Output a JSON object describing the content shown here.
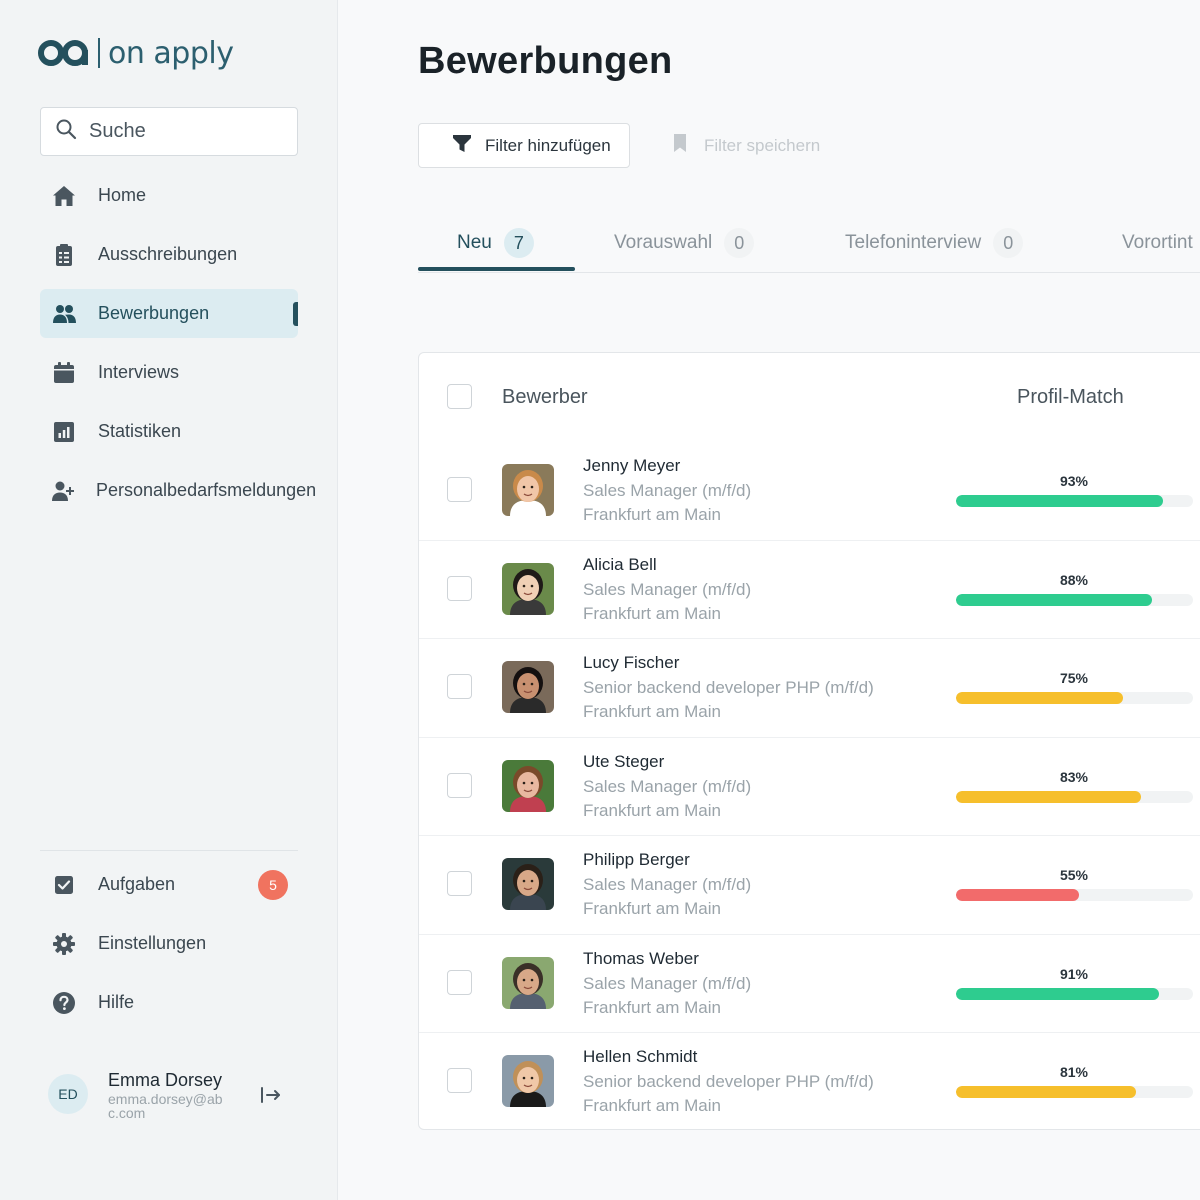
{
  "brand": {
    "name": "on apply",
    "color": "#24505d"
  },
  "search": {
    "placeholder": "Suche"
  },
  "nav": [
    {
      "label": "Home",
      "icon": "home-icon"
    },
    {
      "label": "Ausschreibungen",
      "icon": "clipboard-icon"
    },
    {
      "label": "Bewerbungen",
      "icon": "users-icon",
      "active": true
    },
    {
      "label": "Interviews",
      "icon": "calendar-icon"
    },
    {
      "label": "Statistiken",
      "icon": "chart-icon"
    },
    {
      "label": "Personalbedarfsmeldungen",
      "icon": "user-plus-icon"
    }
  ],
  "bottom_nav": [
    {
      "label": "Aufgaben",
      "icon": "check-square-icon",
      "badge": "5"
    },
    {
      "label": "Einstellungen",
      "icon": "gear-icon"
    },
    {
      "label": "Hilfe",
      "icon": "help-icon"
    }
  ],
  "user": {
    "initials": "ED",
    "name": "Emma Dorsey",
    "email": "emma.dorsey@abc.com"
  },
  "page": {
    "title": "Bewerbungen"
  },
  "toolbar": {
    "filter_label": "Filter hinzufügen",
    "save_label": "Filter speichern"
  },
  "tabs": [
    {
      "label": "Neu",
      "count": "7",
      "active": true
    },
    {
      "label": "Vorauswahl",
      "count": "0"
    },
    {
      "label": "Telefoninterview",
      "count": "0"
    },
    {
      "label": "Vorortint",
      "count": ""
    }
  ],
  "table": {
    "col_applicant": "Bewerber",
    "col_match": "Profil-Match",
    "rows": [
      {
        "name": "Jenny Meyer",
        "job": "Sales Manager (m/f/d)",
        "location": "Frankfurt am Main",
        "match": 93,
        "match_label": "93%"
      },
      {
        "name": "Alicia Bell",
        "job": "Sales Manager (m/f/d)",
        "location": "Frankfurt am Main",
        "match": 88,
        "match_label": "88%"
      },
      {
        "name": "Lucy Fischer",
        "job": "Senior backend developer PHP (m/f/d)",
        "location": "Frankfurt am Main",
        "match": 75,
        "match_label": "75%"
      },
      {
        "name": "Ute Steger",
        "job": "Sales Manager (m/f/d)",
        "location": "Frankfurt am Main",
        "match": 83,
        "match_label": "83%"
      },
      {
        "name": "Philipp Berger",
        "job": "Sales Manager (m/f/d)",
        "location": "Frankfurt am Main",
        "match": 55,
        "match_label": "55%"
      },
      {
        "name": "Thomas Weber",
        "job": "Sales Manager (m/f/d)",
        "location": "Frankfurt am Main",
        "match": 91,
        "match_label": "91%"
      },
      {
        "name": "Hellen Schmidt",
        "job": "Senior backend developer PHP (m/f/d)",
        "location": "Frankfurt am Main",
        "match": 81,
        "match_label": "81%"
      }
    ]
  },
  "colors": {
    "match_high": "#2ecc8f",
    "match_mid": "#f6bf2c",
    "match_low": "#f26b6b"
  }
}
